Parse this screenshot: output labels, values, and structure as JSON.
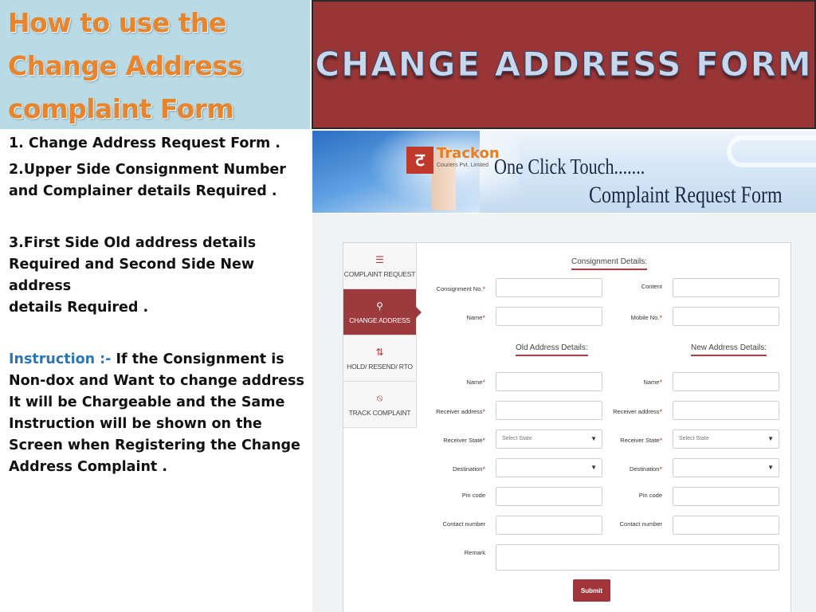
{
  "title": {
    "line1": "How to use the",
    "line2": "Change Address",
    "line3": "complaint Form"
  },
  "banner": {
    "text": "CHANGE ADDRESS FORM"
  },
  "instructions": {
    "item1": "1. Change Address Request Form .",
    "item2_line1": "2.Upper Side Consignment Number",
    "item2_line2": "and Complainer details Required .",
    "item3_line1": "3.First Side Old address details",
    "item3_line2": "Required and Second Side New address",
    "item3_line3": "details Required .",
    "instruction_label": "Instruction :-",
    "instruction_line1": " If the  Consignment is",
    "instruction_line2": "Non-dox and Want to change address",
    "instruction_line3": "It will be Chargeable and the Same",
    "instruction_line4": "Instruction will be shown on the",
    "instruction_line5": "Screen when Registering the Change",
    "instruction_line6": "Address Complaint ."
  },
  "header_strip": {
    "logo_letter": "ट",
    "logo_name": "Trackon",
    "logo_sub": "Couriers Pvt. Limited",
    "tagline": "One Click Touch.......",
    "subtitle": "Complaint Request Form"
  },
  "form": {
    "nav": [
      {
        "icon": "☰",
        "label": "COMPLAINT REQUEST"
      },
      {
        "icon": "⚲",
        "label": "CHANGE ADDRESS"
      },
      {
        "icon": "⇅",
        "label": "HOLD/ RESEND/ RTO"
      },
      {
        "icon": "⦸",
        "label": "TRACK COMPLAINT"
      }
    ],
    "consignment_heading": "Consignment Details:",
    "old_heading": "Old Address Details:",
    "new_heading": "New Address Details:",
    "labels": {
      "consignment_no": "Consignment No.",
      "content": "Content",
      "name": "Name",
      "mobile_no": "Mobile No.",
      "receiver_address": "Receiver address",
      "receiver_state": "Receiver State",
      "destination": "Destination",
      "pin_code": "Pin code",
      "contact_number": "Contact number",
      "remark": "Remark"
    },
    "required_mark": "*",
    "select_state_placeholder": "Select State",
    "caret": "▼",
    "submit_label": "Submit"
  },
  "colors": {
    "title_orange": "#e8842c",
    "banner_red": "#9a3535",
    "accent_red": "#a3353a",
    "instruction_blue": "#2e75b6"
  }
}
